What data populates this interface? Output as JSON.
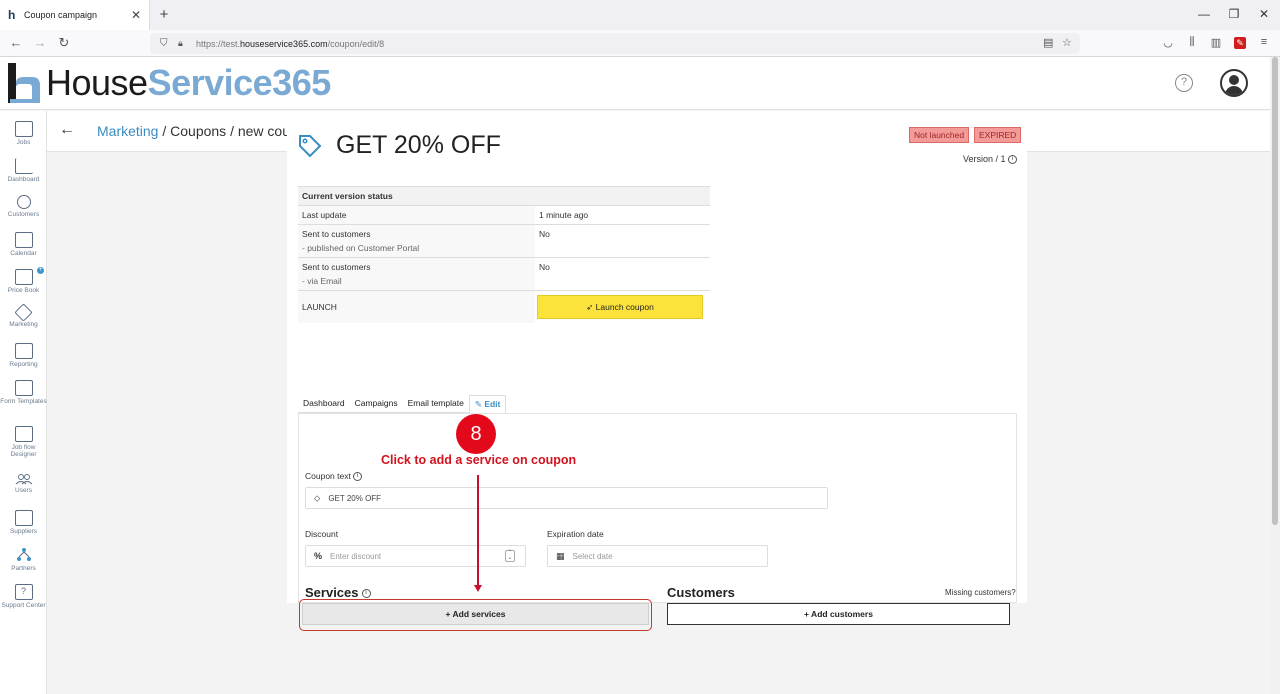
{
  "browser": {
    "tab_title": "Coupon campaign",
    "url_prefix": "https://test.",
    "url_domain": "houseservice365.com",
    "url_path": "/coupon/edit/8"
  },
  "header": {
    "logo_part1": "House",
    "logo_part2": "Service365",
    "help": "?"
  },
  "sidebar": {
    "items": [
      {
        "label": "Jobs"
      },
      {
        "label": "Dashboard"
      },
      {
        "label": "Customers"
      },
      {
        "label": "Calendar"
      },
      {
        "label": "Price Book"
      },
      {
        "label": "Marketing"
      },
      {
        "label": "Reporting"
      },
      {
        "label": "Form Templates"
      },
      {
        "label": "Job flow Designer"
      },
      {
        "label": "Users"
      },
      {
        "label": "Suppliers"
      },
      {
        "label": "Partners"
      },
      {
        "label": "Support Center"
      }
    ]
  },
  "breadcrumb": {
    "link": "Marketing",
    "rest": " / Coupons / new coupon"
  },
  "coupon": {
    "title": "GET 20% OFF",
    "badge_status": "Not launched",
    "badge_expired": "EXPIRED",
    "version": "Version / 1"
  },
  "status_table": {
    "header": "Current version status",
    "rows": [
      {
        "label": "Last update",
        "sub": "",
        "value": "1 minute ago"
      },
      {
        "label": "Sent to customers",
        "sub": "- published on Customer Portal",
        "value": "No"
      },
      {
        "label": "Sent to customers",
        "sub": "- via Email",
        "value": "No"
      }
    ],
    "launch_label": "LAUNCH",
    "launch_button": "Launch coupon"
  },
  "tabs": [
    {
      "label": "Dashboard"
    },
    {
      "label": "Campaigns"
    },
    {
      "label": "Email template"
    },
    {
      "label": "Edit"
    }
  ],
  "annotation": {
    "step": "8",
    "text": "Click to add a service on coupon"
  },
  "form": {
    "coupon_text_label": "Coupon text",
    "coupon_text_value": "GET 20% OFF",
    "discount_label": "Discount",
    "discount_placeholder": "Enter discount",
    "discount_prefix": "%",
    "expiration_label": "Expiration date",
    "expiration_placeholder": "Select date"
  },
  "services": {
    "title": "Services",
    "button": "+ Add services"
  },
  "customers": {
    "title": "Customers",
    "missing_link": "Missing customers?",
    "button": "+ Add customers"
  },
  "colors": {
    "accent": "#3a8dc0",
    "launch": "#fce33b",
    "annotation_red": "#e3091b"
  }
}
